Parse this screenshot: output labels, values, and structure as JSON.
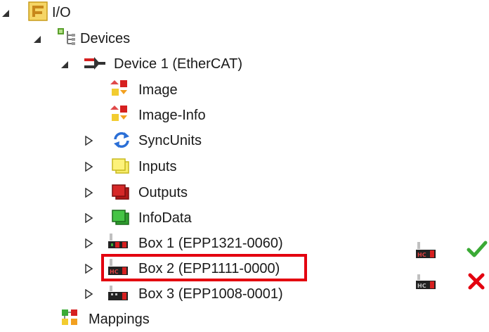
{
  "tree": {
    "io": {
      "label": "I/O"
    },
    "devices": {
      "label": "Devices"
    },
    "device1": {
      "label": "Device 1 (EtherCAT)"
    },
    "image": {
      "label": "Image"
    },
    "image_info": {
      "label": "Image-Info"
    },
    "syncunits": {
      "label": "SyncUnits"
    },
    "inputs": {
      "label": "Inputs"
    },
    "outputs": {
      "label": "Outputs"
    },
    "infodata": {
      "label": "InfoData"
    },
    "box1": {
      "label": "Box 1 (EPP1321-0060)"
    },
    "box2": {
      "label": "Box 2 (EPP1111-0000)"
    },
    "box3": {
      "label": "Box 3 (EPP1008-0001)"
    },
    "mappings": {
      "label": "Mappings"
    }
  },
  "legend": {
    "ok_icon": "check-icon",
    "not_ok_icon": "cross-icon"
  },
  "colors": {
    "highlight": "#e3000f",
    "check": "#3aaa35",
    "cross": "#e3000f"
  }
}
